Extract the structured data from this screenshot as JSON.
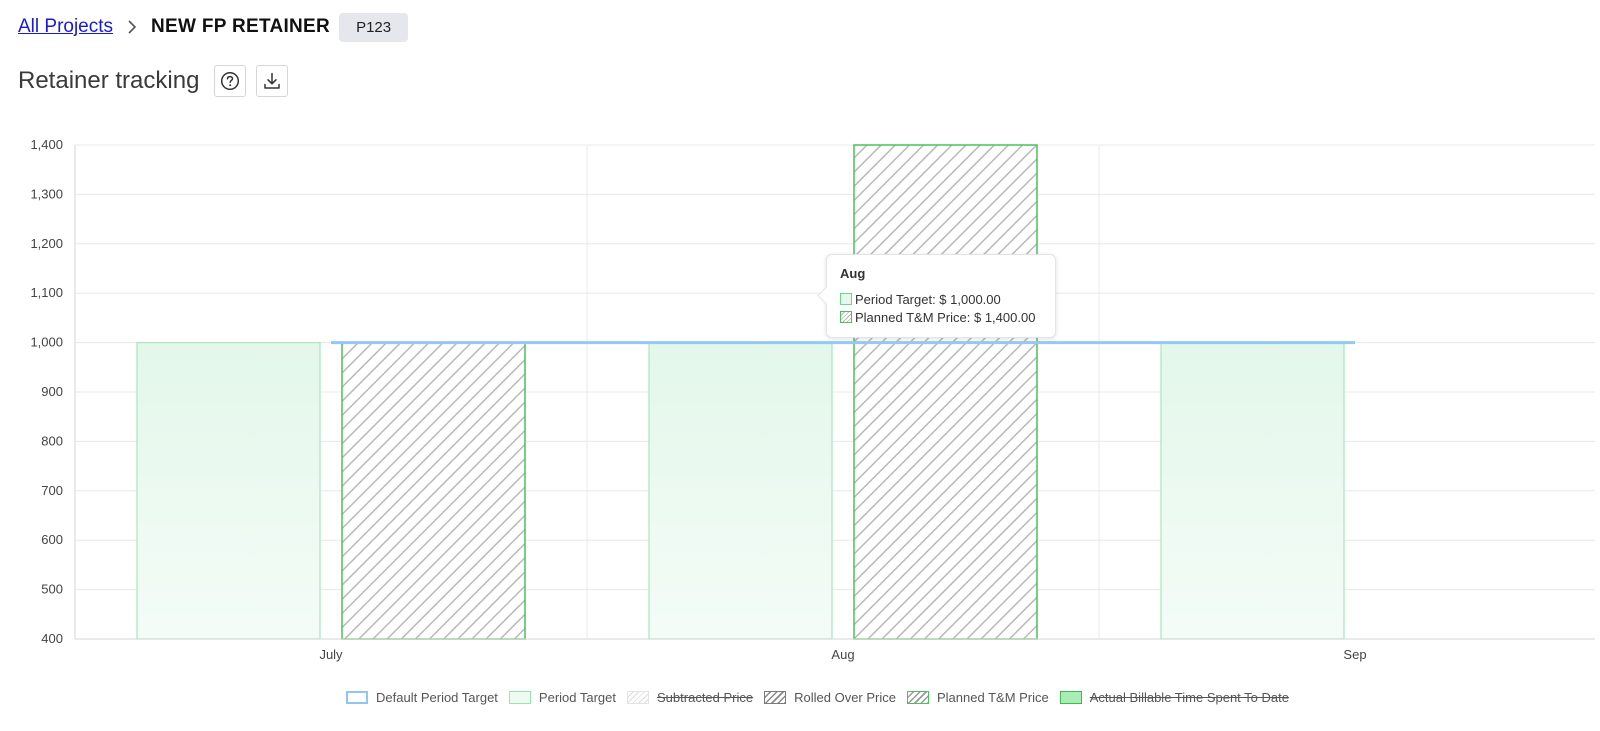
{
  "breadcrumb": {
    "parent_label": "All Projects",
    "current_label": "NEW FP RETAINER",
    "project_code": "P123"
  },
  "header": {
    "title": "Retainer tracking",
    "help_icon": "question-circle-icon",
    "download_icon": "download-icon"
  },
  "colors": {
    "target_fill": "#e6f8ec",
    "target_stroke": "#a8e6bd",
    "planned_stroke": "#4cc05a",
    "default_target_line": "#93c9f3"
  },
  "chart_data": {
    "type": "bar",
    "categories": [
      "July",
      "Aug",
      "Sep"
    ],
    "ylim": [
      400,
      1400
    ],
    "y_ticks": [
      "400",
      "500",
      "600",
      "700",
      "800",
      "900",
      "1,000",
      "1,100",
      "1,200",
      "1,300",
      "1,400"
    ],
    "grid": true,
    "legend_position": "bottom",
    "series": [
      {
        "name": "Default Period Target",
        "kind": "line",
        "values": [
          1000,
          1000,
          1000
        ]
      },
      {
        "name": "Period Target",
        "kind": "bar",
        "values": [
          1000,
          1000,
          1000
        ]
      },
      {
        "name": "Rolled Over Price",
        "kind": "bar",
        "values": [
          1000,
          1400,
          null
        ]
      }
    ]
  },
  "tooltip": {
    "title": "Aug",
    "rows": [
      {
        "label": "Period Target: $ 1,000.00"
      },
      {
        "label": "Planned T&M Price: $ 1,400.00"
      }
    ]
  },
  "legend": [
    {
      "label": "Default Period Target",
      "hidden": false
    },
    {
      "label": "Period Target",
      "hidden": false
    },
    {
      "label": "Subtracted Price",
      "hidden": true
    },
    {
      "label": "Rolled Over Price",
      "hidden": false
    },
    {
      "label": "Planned T&M Price",
      "hidden": false
    },
    {
      "label": "Actual Billable Time Spent To Date",
      "hidden": true
    }
  ]
}
